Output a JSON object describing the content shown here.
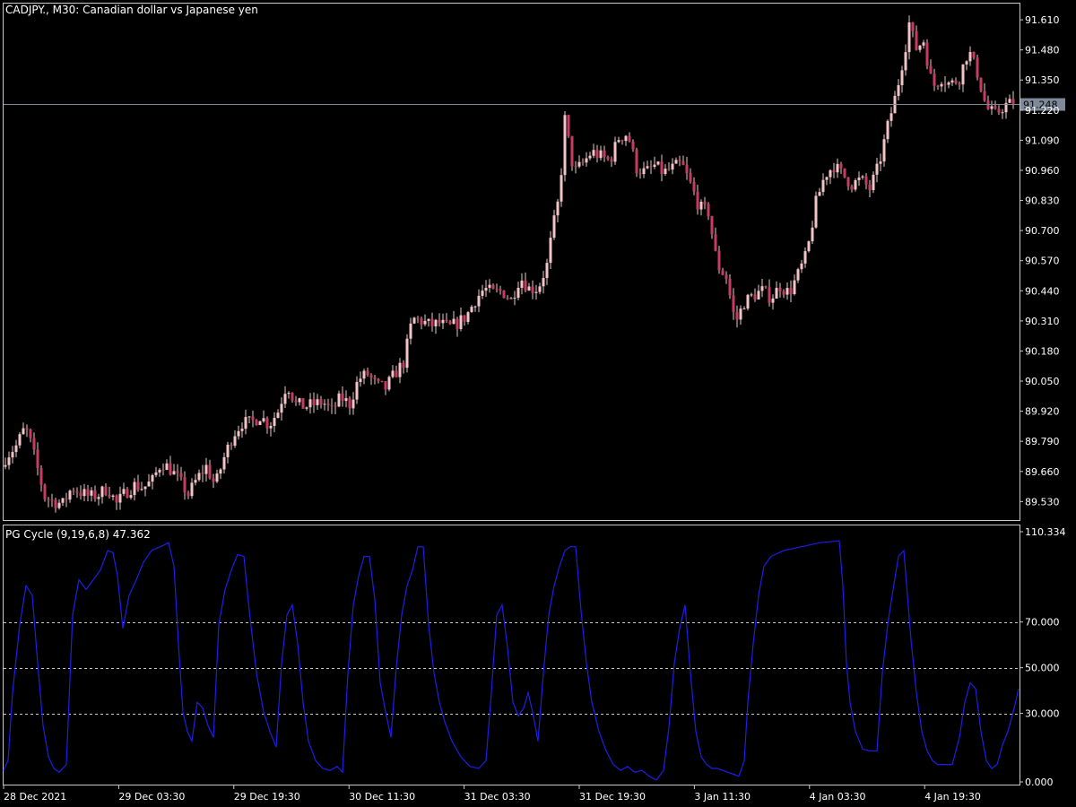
{
  "window": {
    "symbol_title": "CADJPY., M30:  Canadian dollar vs Japanese yen",
    "indicator_title": "PG Cycle (9,19,6,8) 47.362"
  },
  "colors": {
    "background": "#000000",
    "frame": "#c8c8c8",
    "bull_candle": "#f2c4c8",
    "bear_candle": "#c83c64",
    "wick": "#e8c8cc",
    "indicator_line": "#1e1ee6",
    "level_line": "#c8c8c8",
    "bid_line": "#7e8a9a",
    "bid_label_bg": "#7e8a9a",
    "text": "#ffffff"
  },
  "chart_data": [
    {
      "type": "candlestick",
      "panel": "price",
      "title": "CADJPY., M30:  Canadian dollar vs Japanese yen",
      "ylim": [
        89.45,
        91.68
      ],
      "y_ticks": [
        "91.610",
        "91.480",
        "91.350",
        "91.220",
        "91.090",
        "90.960",
        "90.830",
        "90.700",
        "90.570",
        "90.440",
        "90.310",
        "90.180",
        "90.050",
        "89.920",
        "89.790",
        "89.660",
        "89.530"
      ],
      "current_price": "91.248",
      "path_x": [
        0,
        8,
        18,
        28,
        33,
        40,
        50,
        60,
        70,
        80,
        90,
        100,
        110,
        120,
        130,
        140,
        150,
        160,
        170,
        180,
        190,
        200,
        210,
        220,
        230,
        240,
        250,
        260,
        270,
        280,
        290,
        300,
        310,
        320,
        330,
        340,
        350,
        360,
        370,
        380,
        390,
        400,
        410,
        420,
        430,
        440,
        450,
        460,
        470,
        480,
        490,
        500,
        510,
        520,
        530,
        540,
        550,
        560,
        570,
        580,
        590,
        600,
        610,
        616,
        624,
        630,
        640,
        650,
        660,
        670,
        680,
        690,
        700,
        710,
        720,
        730,
        740,
        750,
        760,
        770,
        780,
        790,
        800,
        810,
        820,
        830,
        840,
        850,
        860,
        870,
        880,
        890,
        900,
        910,
        920,
        930,
        940,
        950,
        960,
        970,
        980,
        990,
        1000,
        1010,
        1015,
        1020,
        1030,
        1040,
        1050,
        1060,
        1070,
        1080,
        1090,
        1100,
        1110,
        1120,
        1128
      ],
      "path_close": [
        89.68,
        89.73,
        89.77,
        89.85,
        89.8,
        89.7,
        89.55,
        89.53,
        89.52,
        89.59,
        89.57,
        89.55,
        89.56,
        89.59,
        89.52,
        89.57,
        89.6,
        89.59,
        89.62,
        89.7,
        89.67,
        89.62,
        89.56,
        89.63,
        89.68,
        89.6,
        89.72,
        89.82,
        89.87,
        89.87,
        89.9,
        89.86,
        89.92,
        90.04,
        89.95,
        89.94,
        89.95,
        89.96,
        89.92,
        89.98,
        89.95,
        90.06,
        90.08,
        90.03,
        90.02,
        90.08,
        90.13,
        90.32,
        90.31,
        90.29,
        90.3,
        90.28,
        90.3,
        90.33,
        90.4,
        90.45,
        90.43,
        90.44,
        90.4,
        90.5,
        90.45,
        90.45,
        90.55,
        90.7,
        90.85,
        91.18,
        90.95,
        90.99,
        91.04,
        91.02,
        91.0,
        91.1,
        91.12,
        90.97,
        90.95,
        90.98,
        90.95,
        90.97,
        90.99,
        90.9,
        90.8,
        90.78,
        90.55,
        90.5,
        90.3,
        90.39,
        90.42,
        90.44,
        90.41,
        90.46,
        90.43,
        90.51,
        90.6,
        90.82,
        90.94,
        90.98,
        90.94,
        90.9,
        90.92,
        90.88,
        90.98,
        91.15,
        91.3,
        91.5,
        91.62,
        91.48,
        91.52,
        91.32,
        91.36,
        91.33,
        91.36,
        91.48,
        91.38,
        91.23,
        91.2,
        91.24,
        91.25
      ],
      "last_close": 91.248
    },
    {
      "type": "line",
      "panel": "indicator",
      "title": "PG Cycle (9,19,6,8) 47.362",
      "series": [
        {
          "name": "PG Cycle",
          "x": [
            0,
            5,
            10,
            18,
            25,
            32,
            38,
            44,
            50,
            56,
            62,
            70,
            77,
            84,
            92,
            100,
            108,
            116,
            122,
            127,
            133,
            140,
            148,
            156,
            165,
            175,
            184,
            190,
            195,
            200,
            205,
            210,
            216,
            222,
            228,
            234,
            240,
            247,
            254,
            261,
            268,
            274,
            282,
            290,
            297,
            304,
            310,
            316,
            322,
            328,
            334,
            340,
            348,
            356,
            364,
            372,
            378,
            384,
            390,
            396,
            402,
            408,
            414,
            420,
            426,
            432,
            438,
            444,
            450,
            456,
            462,
            468,
            474,
            480,
            486,
            492,
            500,
            510,
            520,
            530,
            538,
            544,
            550,
            556,
            562,
            568,
            574,
            580,
            585,
            590,
            596,
            602,
            608,
            614,
            620,
            626,
            632,
            638,
            644,
            650,
            656,
            664,
            672,
            680,
            688,
            696,
            704,
            712,
            720,
            728,
            736,
            742,
            748,
            754,
            760,
            766,
            772,
            778,
            784,
            790,
            796,
            802,
            808,
            814,
            820,
            826,
            830,
            836,
            842,
            848,
            856,
            870,
            890,
            910,
            932,
            936,
            940,
            944,
            950,
            958,
            966,
            974,
            980,
            986,
            992,
            998,
            1004,
            1012,
            1018,
            1024,
            1030,
            1036,
            1042,
            1050,
            1058,
            1066,
            1072,
            1078,
            1084,
            1090,
            1096,
            1102,
            1108,
            1114,
            1120,
            1126,
            1132
          ],
          "values": [
            5,
            10,
            45,
            80,
            100,
            95,
            60,
            28,
            12,
            6,
            4,
            8,
            85,
            103,
            98,
            103,
            108,
            118,
            117,
            105,
            78,
            95,
            103,
            112,
            118,
            120,
            122,
            110,
            70,
            35,
            25,
            20,
            40,
            37,
            28,
            22,
            80,
            98,
            108,
            116,
            115,
            87,
            55,
            35,
            25,
            17,
            60,
            85,
            90,
            70,
            40,
            20,
            10,
            6,
            5,
            7,
            4,
            55,
            90,
            105,
            115,
            115,
            93,
            50,
            35,
            22,
            58,
            85,
            100,
            108,
            120,
            120,
            80,
            55,
            40,
            30,
            20,
            12,
            7,
            6,
            10,
            45,
            85,
            90,
            68,
            40,
            33,
            37,
            45,
            35,
            20,
            55,
            85,
            100,
            110,
            118,
            120,
            120,
            87,
            60,
            40,
            25,
            15,
            8,
            5,
            7,
            4,
            5,
            2,
            0,
            5,
            27,
            60,
            78,
            90,
            55,
            25,
            12,
            8,
            6,
            6,
            5,
            4,
            3,
            2,
            10,
            40,
            70,
            95,
            110,
            115,
            118,
            120,
            122,
            123,
            100,
            60,
            40,
            25,
            16,
            15,
            15,
            55,
            80,
            98,
            115,
            118,
            72,
            45,
            25,
            15,
            10,
            8,
            8,
            8,
            22,
            40,
            50,
            47,
            25,
            10,
            6,
            8,
            18,
            25,
            35,
            47
          ]
        }
      ],
      "ylim": [
        0,
        110.334
      ],
      "y_ticks": [
        "110.334",
        "70.000",
        "50.000",
        "30.000",
        "0.000"
      ],
      "levels": [
        70,
        50,
        30
      ],
      "grid": false,
      "legend": "none"
    }
  ],
  "x_axis": {
    "labels": [
      "28 Dec 2021",
      "29 Dec 03:30",
      "29 Dec 19:30",
      "30 Dec 11:30",
      "31 Dec 03:30",
      "31 Dec 19:30",
      "3 Jan 11:30",
      "4 Jan 03:30",
      "4 Jan 19:30"
    ]
  }
}
